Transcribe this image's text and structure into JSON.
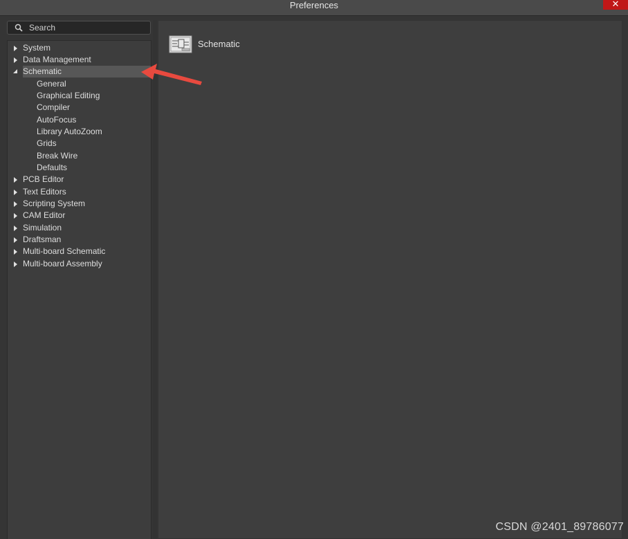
{
  "window": {
    "title": "Preferences",
    "close_glyph": "✕"
  },
  "search": {
    "label": "Search",
    "icon": "search-icon"
  },
  "tree": {
    "items": [
      {
        "label": "System",
        "expanded": false,
        "level": 0
      },
      {
        "label": "Data Management",
        "expanded": false,
        "level": 0
      },
      {
        "label": "Schematic",
        "expanded": true,
        "level": 0,
        "selected": true
      },
      {
        "label": "General",
        "level": 1
      },
      {
        "label": "Graphical Editing",
        "level": 1
      },
      {
        "label": "Compiler",
        "level": 1
      },
      {
        "label": "AutoFocus",
        "level": 1
      },
      {
        "label": "Library AutoZoom",
        "level": 1
      },
      {
        "label": "Grids",
        "level": 1
      },
      {
        "label": "Break Wire",
        "level": 1
      },
      {
        "label": "Defaults",
        "level": 1
      },
      {
        "label": "PCB Editor",
        "expanded": false,
        "level": 0
      },
      {
        "label": "Text Editors",
        "expanded": false,
        "level": 0
      },
      {
        "label": "Scripting System",
        "expanded": false,
        "level": 0
      },
      {
        "label": "CAM Editor",
        "expanded": false,
        "level": 0
      },
      {
        "label": "Simulation",
        "expanded": false,
        "level": 0
      },
      {
        "label": "Draftsman",
        "expanded": false,
        "level": 0
      },
      {
        "label": "Multi-board Schematic",
        "expanded": false,
        "level": 0
      },
      {
        "label": "Multi-board Assembly",
        "expanded": false,
        "level": 0
      }
    ]
  },
  "content": {
    "title": "Schematic",
    "icon": "schematic-sheet-icon"
  },
  "watermark": "CSDN @2401_89786077",
  "colors": {
    "close_button": "#c01818",
    "annotation_arrow": "#e84a3f",
    "selected_row": "#575757"
  }
}
